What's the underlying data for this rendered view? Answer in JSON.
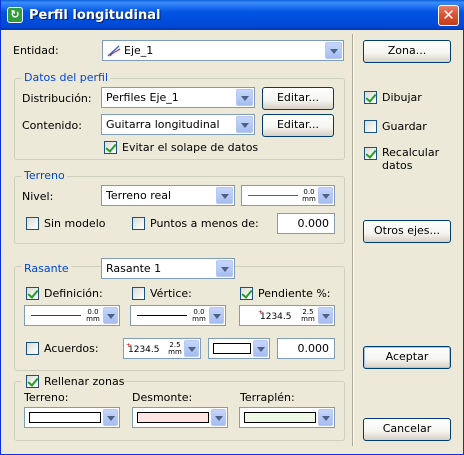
{
  "window": {
    "title": "Perfil longitudinal",
    "close_label": "✕"
  },
  "entidad": {
    "label": "Entidad:",
    "value": "Eje_1"
  },
  "datos_perfil": {
    "group_label": "Datos del perfil",
    "distribucion_label": "Distribución:",
    "distribucion_value": "Perfiles Eje_1",
    "contenido_label": "Contenido:",
    "contenido_value": "Guitarra longitudinal",
    "editar1": "Editar...",
    "editar2": "Editar...",
    "evitar_label": "Evitar el solape de datos",
    "evitar_checked": true
  },
  "terreno": {
    "group_label": "Terreno",
    "nivel_label": "Nivel:",
    "nivel_value": "Terreno real",
    "line_value": "0.0",
    "line_unit": "mm",
    "line_color": "#2e7d32",
    "sin_modelo_label": "Sin modelo",
    "puntos_label": "Puntos a menos de:",
    "puntos_value": "0.000"
  },
  "rasante": {
    "group_label": "Rasante",
    "rasante_value": "Rasante 1",
    "definicion_label": "Definición:",
    "definicion_checked": true,
    "definicion_line_value": "0.0",
    "definicion_unit": "mm",
    "definicion_color": "#cc0000",
    "vertice_label": "Vértice:",
    "vertice_line_value": "0.0",
    "vertice_unit": "mm",
    "pendiente_label": "Pendiente %:",
    "pendiente_checked": true,
    "pendiente_text": "1234.5",
    "pendiente_size": "2.5",
    "pendiente_unit": "mm",
    "acuerdos_label": "Acuerdos:",
    "acuerdos_text": "1234.5",
    "acuerdos_size": "2.5",
    "acuerdos_unit": "mm",
    "acuerdos_value": "0.000"
  },
  "rellenar": {
    "label": "Rellenar zonas",
    "checked": true,
    "terreno_label": "Terreno:",
    "desmonte_label": "Desmonte:",
    "terraplen_label": "Terraplén:",
    "terreno_color": "#ffffff",
    "desmonte_color": "#ffe4e4",
    "terraplen_color": "#eef8e6"
  },
  "side": {
    "zona_button": "Zona...",
    "dibujar_label": "Dibujar",
    "dibujar_checked": true,
    "guardar_label": "Guardar",
    "guardar_checked": false,
    "recalcular_label1": "Recalcular",
    "recalcular_label2": "datos",
    "recalcular_checked": true,
    "otros_button": "Otros ejes...",
    "aceptar_button": "Aceptar",
    "cancelar_button": "Cancelar"
  }
}
